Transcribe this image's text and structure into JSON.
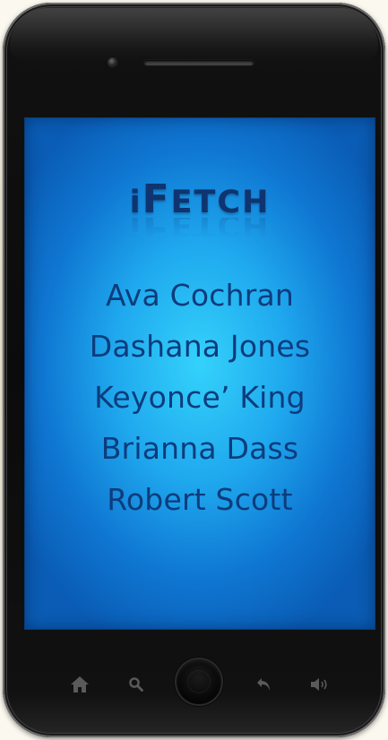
{
  "app": {
    "title_parts": [
      "i",
      "F",
      "ETCH"
    ]
  },
  "names": [
    "Ava Cochran",
    "Dashana Jones",
    "Keyonce’ King",
    "Brianna Dass",
    "Robert Scott"
  ],
  "nav": {
    "icons": [
      "home-icon",
      "search-icon",
      "home-button",
      "back-icon",
      "volume-icon"
    ]
  },
  "colors": {
    "screen_center": "#34d2fb",
    "screen_edge": "#0a5cb4",
    "text": "#0d3c7c",
    "bezel": "#0b0b0b"
  }
}
